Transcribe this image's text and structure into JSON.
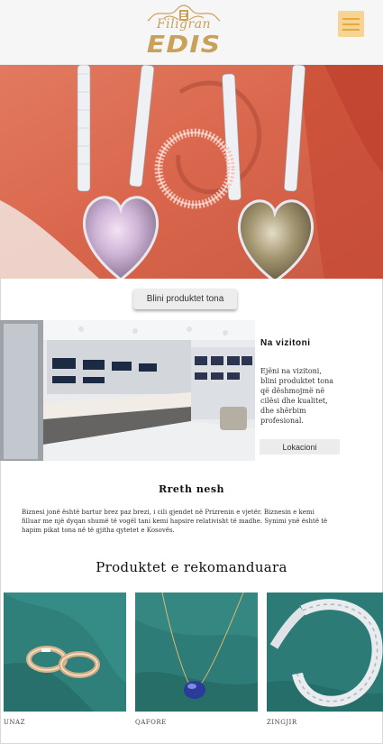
{
  "brand": {
    "script": "Filigran",
    "name": "EDIS"
  },
  "hero": {
    "button_label": "Blini produktet tona"
  },
  "visit": {
    "title": "Na vizitoni",
    "text": "Ejëni na vizitoni, blini produktet tona që dëshmojmë në cilësi dhe kualitet, dhe shërbim profesional.",
    "button_label": "Lokacioni"
  },
  "about": {
    "title": "Rreth nesh",
    "text": "Biznesi jonë është bartur brez paz brezi, i cili gjendet në Prizrenin e vjetër. Biznesin e kemi filluar me një dyqan shumë të vogël tani kemi hapsire relativisht të madhe. Synimi ynë është të hapim pikat tona në të gjitha qytetet e Kosovës."
  },
  "products": {
    "title": "Produktet e rekomanduara",
    "items": [
      {
        "label": "UNAZ"
      },
      {
        "label": "QAFORE"
      },
      {
        "label": "ZINGJIR"
      }
    ]
  },
  "colors": {
    "gold": "#c9a15a",
    "menu_bg": "#f7d493",
    "menu_lines": "#e8a93a",
    "hero_bg": "#e0745a",
    "product_bg": "#2e7c78"
  },
  "icons": {
    "menu": "hamburger-menu-icon"
  }
}
